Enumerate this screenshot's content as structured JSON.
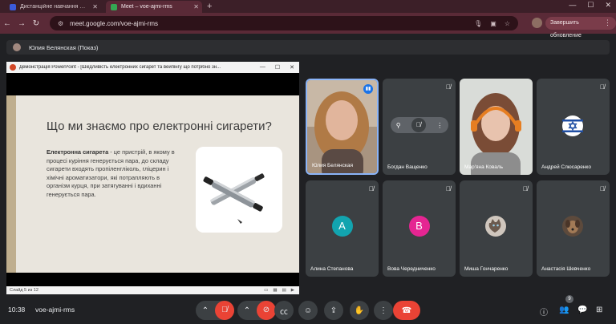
{
  "browser": {
    "tabs": [
      {
        "label": "Дистанційне навчання в ВСП",
        "active": false,
        "favicon_color": "#3b5bdb"
      },
      {
        "label": "Meet – voe-ajmi-rms",
        "active": true,
        "favicon_color": "#34a853"
      }
    ],
    "url": "meet.google.com/voe-ajmi-rms",
    "update_button": "Завершить обновление"
  },
  "meet": {
    "presenter_banner": "Юлия Белянская (Показ)",
    "time": "10:38",
    "meeting_code": "voe-ajmi-rms",
    "participants_badge": "9"
  },
  "ppt": {
    "window_title": "Демонстрація PowerPoint - [Шкідливість електронних сигарет та вейпінгу що потрібно зн...",
    "slide_title": "Що ми знаємо про електронні сигарети?",
    "body_bold": "Електронна сигарета",
    "body_text": " - це пристрій, в якому в процесі куріння генерується пара, до складу сигарети входять пропіленгліколь, гліцерин і хімічні ароматизатори, які потрапляють в організм курця, при затягуванні і вдиханні генерується пара.",
    "status": "Слайд 5 из 12"
  },
  "participants": [
    {
      "name": "Юлия Белянская",
      "kind": "video-woman",
      "speaking": true
    },
    {
      "name": "Богдан Ващенко",
      "kind": "blank",
      "muted": true
    },
    {
      "name": "Мар'яна Коваль",
      "kind": "video-girl"
    },
    {
      "name": "Андрей Слюсаренко",
      "kind": "flag",
      "muted": true
    },
    {
      "name": "Алина Степанова",
      "kind": "letter",
      "letter": "A",
      "color": "#12a4af",
      "muted": true
    },
    {
      "name": "Вова Чередниченко",
      "kind": "letter",
      "letter": "B",
      "color": "#e52592",
      "muted": true
    },
    {
      "name": "Миша Гончаренко",
      "kind": "avatar-cat",
      "muted": true
    },
    {
      "name": "Анастасія Шевченко",
      "kind": "avatar-dog",
      "muted": true
    }
  ]
}
